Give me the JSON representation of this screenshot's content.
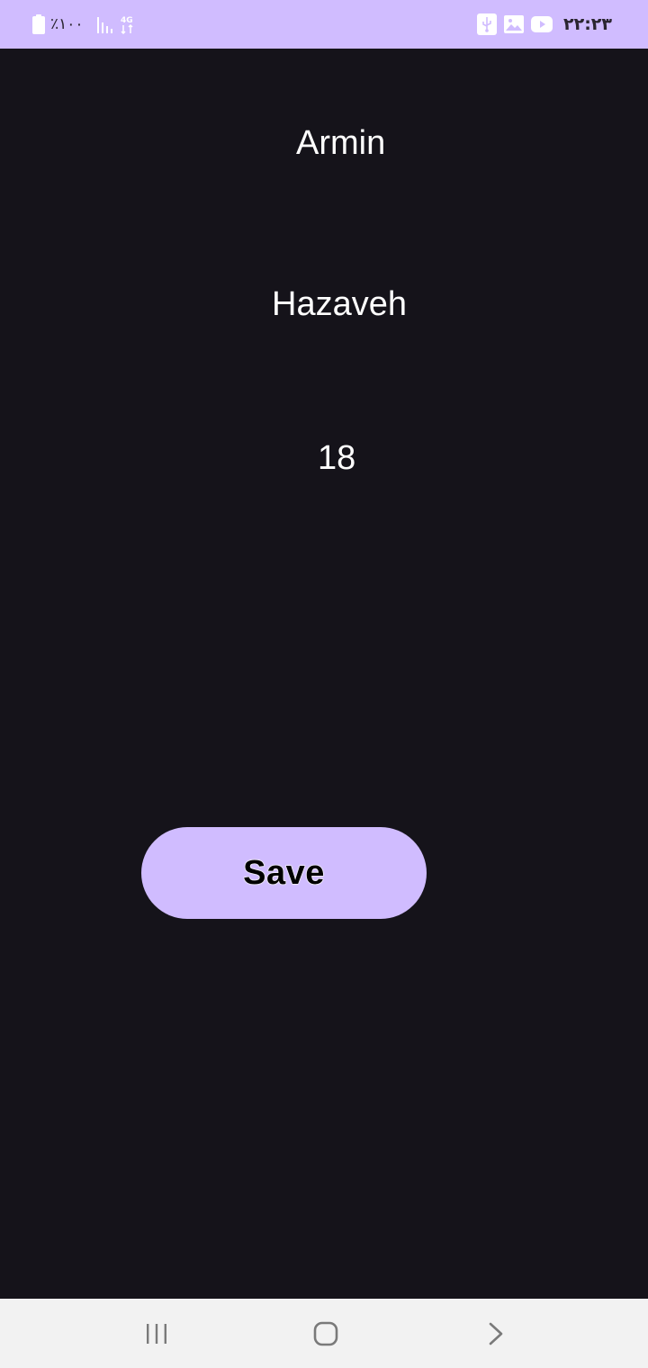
{
  "status_bar": {
    "battery_text": "٪۱۰۰",
    "clock": "۲۲:۲۳",
    "icons_left": [
      "battery-icon",
      "signal-icon",
      "4g-icon"
    ],
    "icons_right": [
      "usb-icon",
      "gallery-icon",
      "youtube-icon"
    ]
  },
  "fields": {
    "first_name": "Armin",
    "last_name": "Hazaveh",
    "age": "18"
  },
  "save_button": {
    "label": "Save"
  },
  "navigation": {
    "buttons": [
      "recents",
      "home",
      "back"
    ]
  },
  "colors": {
    "accent": "#d0bcff",
    "background": "#15131a",
    "nav_background": "#f2f2f2",
    "text": "#ffffff"
  }
}
